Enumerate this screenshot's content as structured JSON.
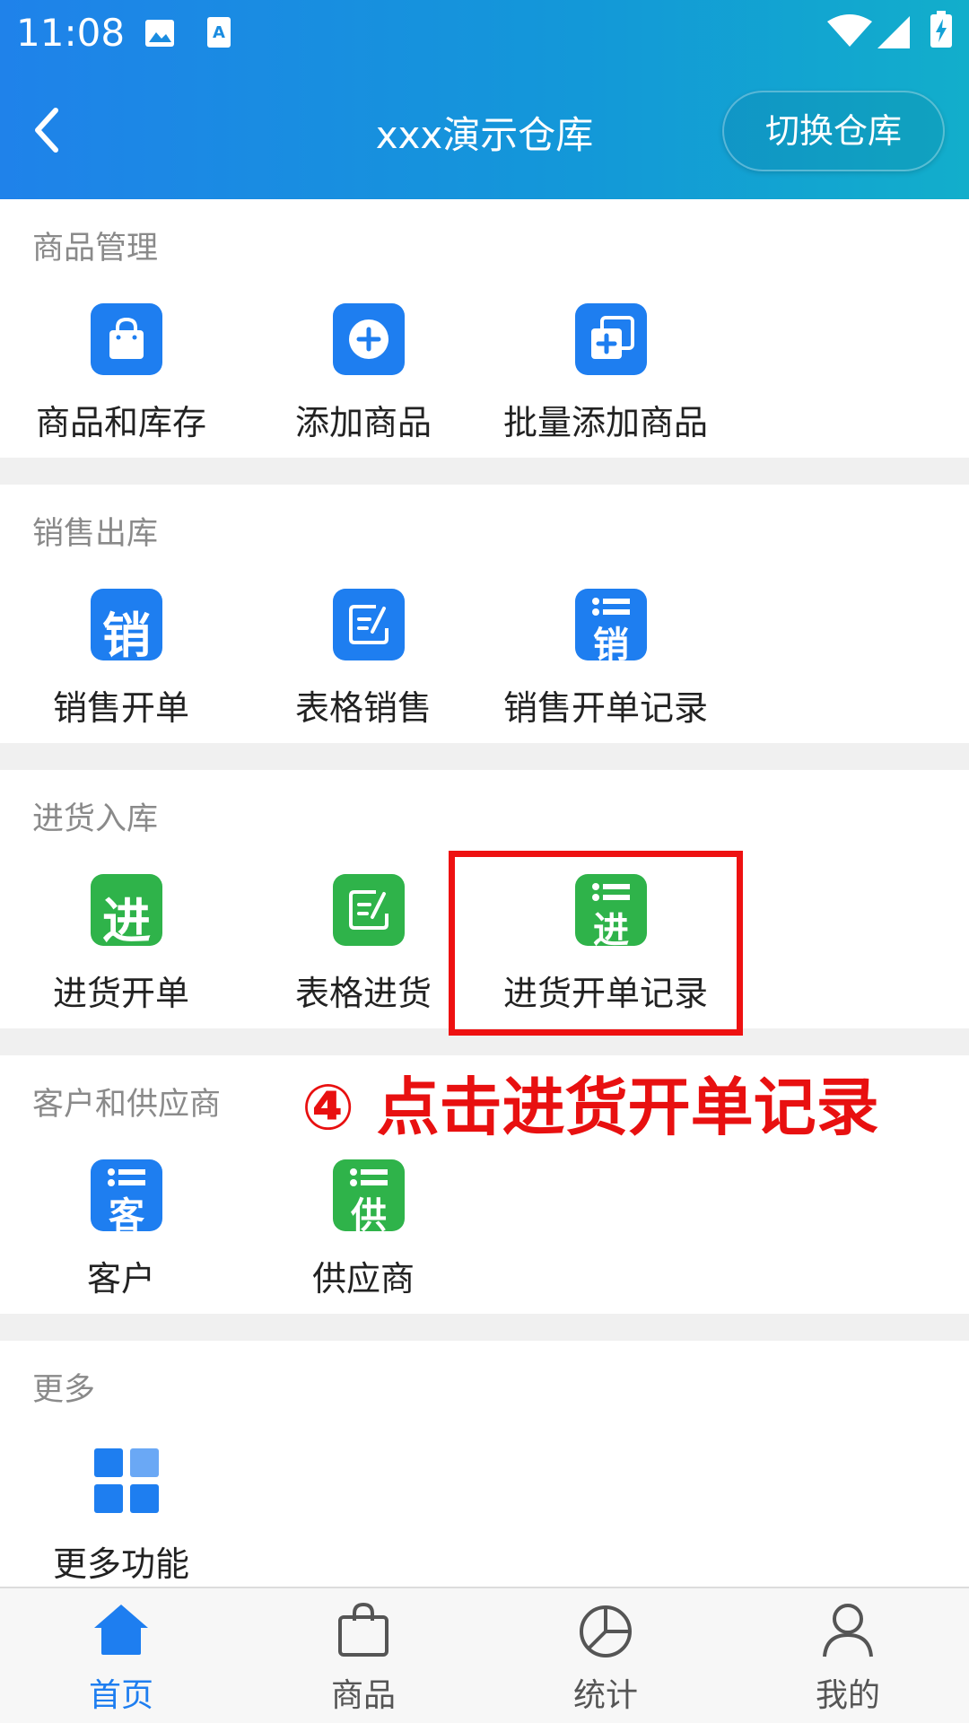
{
  "status_bar": {
    "time": "11:08"
  },
  "header": {
    "title": "xxx演示仓库",
    "switch_button": "切换仓库"
  },
  "colors": {
    "blue": "#1e7ef0",
    "green": "#2fb34a",
    "highlight": "#ee1111",
    "nav_active": "#1e7ef0"
  },
  "sections": {
    "goods": {
      "title": "商品管理",
      "items": [
        {
          "label": "商品和库存",
          "icon": "shopping-bag-icon"
        },
        {
          "label": "添加商品",
          "icon": "plus-circle-icon"
        },
        {
          "label": "批量添加商品",
          "icon": "batch-add-icon"
        }
      ]
    },
    "sales": {
      "title": "销售出库",
      "items": [
        {
          "label": "销售开单",
          "icon": "sales-order-icon",
          "char": "销"
        },
        {
          "label": "表格销售",
          "icon": "edit-sheet-icon"
        },
        {
          "label": "销售开单记录",
          "icon": "sales-record-icon",
          "char": "销"
        }
      ]
    },
    "purchase": {
      "title": "进货入库",
      "items": [
        {
          "label": "进货开单",
          "icon": "purchase-order-icon",
          "char": "进"
        },
        {
          "label": "表格进货",
          "icon": "edit-sheet-icon"
        },
        {
          "label": "进货开单记录",
          "icon": "purchase-record-icon",
          "char": "进"
        }
      ]
    },
    "partners": {
      "title": "客户和供应商",
      "items": [
        {
          "label": "客户",
          "icon": "customer-icon",
          "char": "客"
        },
        {
          "label": "供应商",
          "icon": "supplier-icon",
          "char": "供"
        }
      ]
    },
    "more": {
      "title": "更多",
      "items": [
        {
          "label": "更多功能",
          "icon": "grid-icon"
        }
      ]
    }
  },
  "annotation": "④ 点击进货开单记录",
  "bottom_nav": [
    {
      "label": "首页",
      "icon": "home-icon",
      "active": true
    },
    {
      "label": "商品",
      "icon": "bag-icon",
      "active": false
    },
    {
      "label": "统计",
      "icon": "pie-chart-icon",
      "active": false
    },
    {
      "label": "我的",
      "icon": "user-icon",
      "active": false
    }
  ]
}
